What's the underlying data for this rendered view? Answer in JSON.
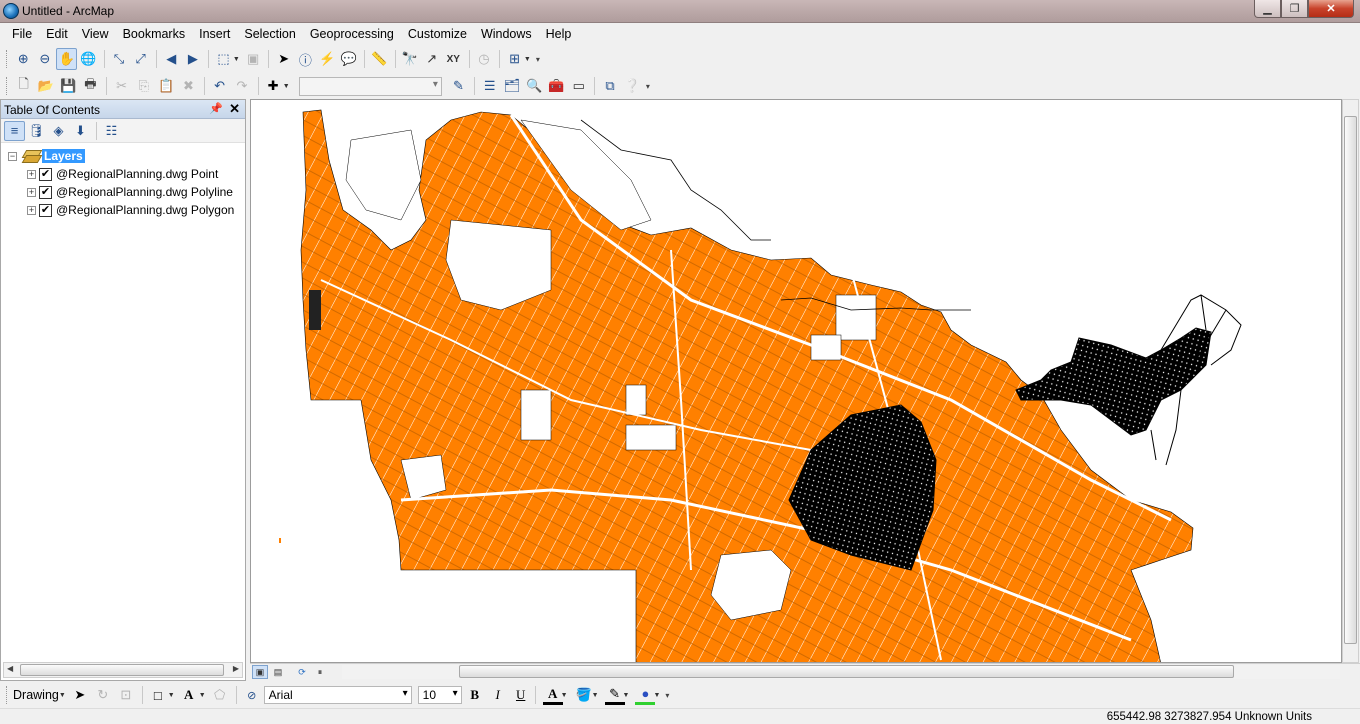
{
  "window": {
    "title": "Untitled - ArcMap"
  },
  "menu": [
    "File",
    "Edit",
    "View",
    "Bookmarks",
    "Insert",
    "Selection",
    "Geoprocessing",
    "Customize",
    "Windows",
    "Help"
  ],
  "toc": {
    "title": "Table Of Contents",
    "root_label": "Layers",
    "layers": [
      {
        "label": "@RegionalPlanning.dwg Point",
        "checked": true
      },
      {
        "label": "@RegionalPlanning.dwg Polyline",
        "checked": true
      },
      {
        "label": "@RegionalPlanning.dwg Polygon",
        "checked": true
      }
    ]
  },
  "drawing_toolbar": {
    "label": "Drawing",
    "font": "Arial",
    "font_size": "10",
    "bold": "B",
    "italic": "I",
    "underline": "U",
    "text_tool": "A"
  },
  "status": {
    "coordinates": "655442.98  3273827.954 Unknown Units"
  },
  "colors": {
    "map_fill": "#ff8000",
    "selection": "#3399ff"
  }
}
